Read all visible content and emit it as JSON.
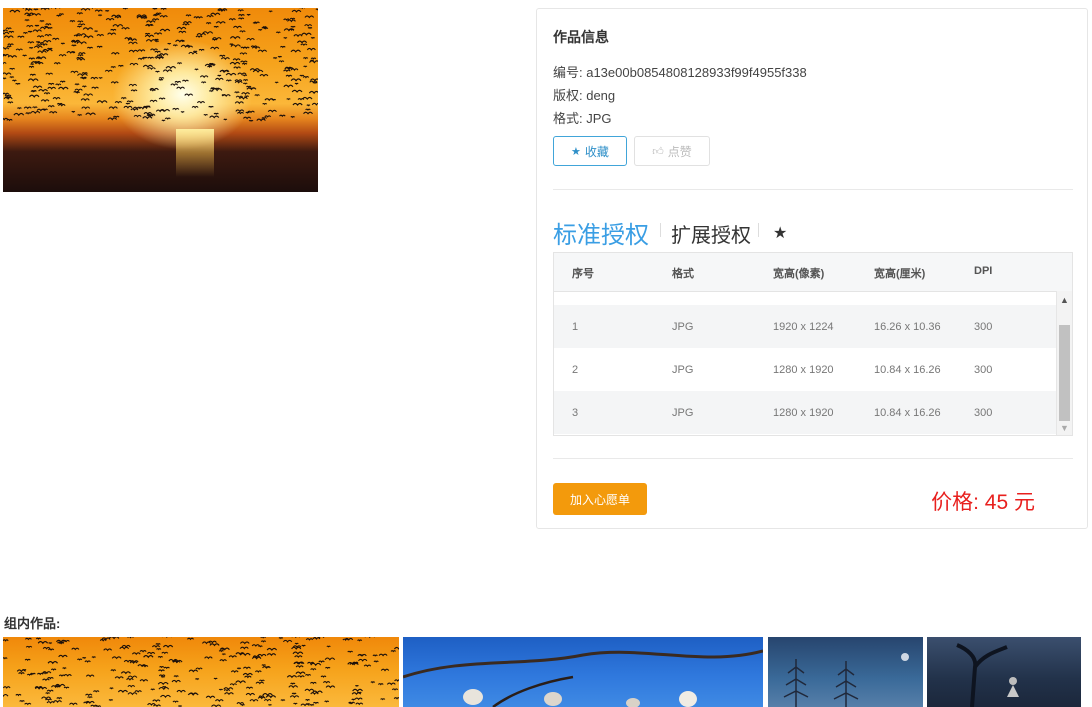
{
  "artwork": {
    "image_alt": "sunset with birds",
    "info_title": "作品信息",
    "id_line": "编号: a13e00b0854808128933f99f4955f338",
    "copyright_line": "版权: deng",
    "format_line": "格式: JPG",
    "favorite_label": "收藏",
    "like_label": "点赞"
  },
  "license": {
    "tabs": [
      "标准授权",
      "扩展授权"
    ],
    "active_tab": "标准授权",
    "columns": [
      "序号",
      "格式",
      "宽高(像素)",
      "宽高(厘米)",
      "DPI"
    ],
    "rows": [
      {
        "index": "1",
        "format": "JPG",
        "px": "1920 x 1224",
        "cm": "16.26 x 10.36",
        "dpi": "300"
      },
      {
        "index": "2",
        "format": "JPG",
        "px": "1280 x 1920",
        "cm": "10.84 x 16.26",
        "dpi": "300"
      },
      {
        "index": "3",
        "format": "JPG",
        "px": "1280 x 1920",
        "cm": "10.84 x 16.26",
        "dpi": "300"
      }
    ]
  },
  "actions": {
    "wishlist_label": "加入心愿单",
    "price": "价格: 45 元"
  },
  "group": {
    "label": "组内作品:"
  },
  "colors": {
    "accent_blue": "#3a9ee4",
    "wishlist_orange": "#f39a0c",
    "price_red": "#e8201e"
  }
}
